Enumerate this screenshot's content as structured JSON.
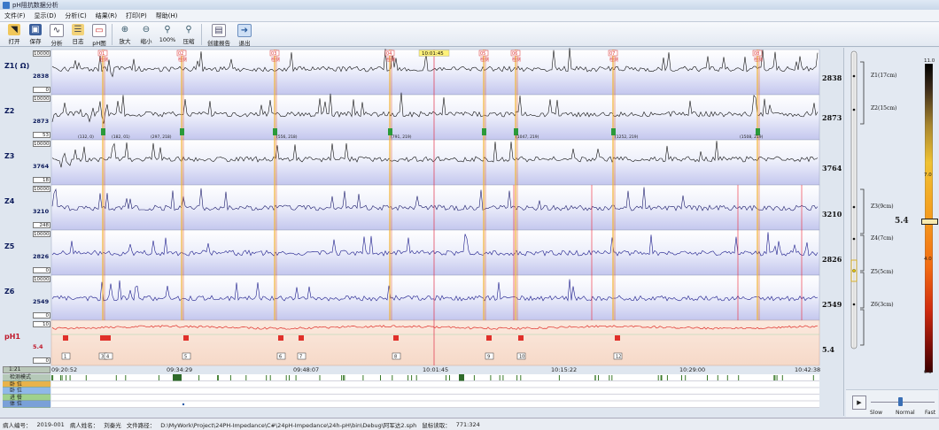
{
  "window": {
    "title": "pH阻抗数据分析"
  },
  "menu": [
    "文件(F)",
    "显示(D)",
    "分析(C)",
    "结果(R)",
    "打印(P)",
    "帮助(H)"
  ],
  "toolbar": [
    {
      "label": "打开",
      "icon": "folder-open-icon"
    },
    {
      "label": "保存",
      "icon": "save-icon"
    },
    {
      "label": "分析",
      "icon": "analysis-icon"
    },
    {
      "label": "日志",
      "icon": "log-icon"
    },
    {
      "label": "pH图",
      "icon": "ph-chart-icon"
    },
    {
      "label": "放大",
      "icon": "zoom-in-icon"
    },
    {
      "label": "缩小",
      "icon": "zoom-out-icon"
    },
    {
      "label": "100%",
      "icon": "zoom-100-icon"
    },
    {
      "label": "压缩",
      "icon": "compress-icon"
    },
    {
      "label": "创建报告",
      "icon": "report-icon"
    },
    {
      "label": "退出",
      "icon": "exit-icon"
    }
  ],
  "channels": [
    {
      "name": "Z1( Ω)",
      "current": "2838",
      "max": "10000",
      "min": "0",
      "value": "2838"
    },
    {
      "name": "Z2",
      "current": "2873",
      "max": "10000",
      "min": "53",
      "value": "2873"
    },
    {
      "name": "Z3",
      "current": "3764",
      "max": "10000",
      "min": "18",
      "value": "3764"
    },
    {
      "name": "Z4",
      "current": "3210",
      "max": "10000",
      "min": "248",
      "value": "3210"
    },
    {
      "name": "Z5",
      "current": "2826",
      "max": "10000",
      "min": "0",
      "value": "2826"
    },
    {
      "name": "Z6",
      "current": "2549",
      "max": "10000",
      "min": "0",
      "value": "2549"
    }
  ],
  "ph": {
    "name": "pH1",
    "current": "5.4",
    "max": "10",
    "min": "0",
    "value": "5.4"
  },
  "time_axis": [
    "09:20:52",
    "09:34:29",
    "09:48:07",
    "10:01:45",
    "10:15:22",
    "10:29:00",
    "10:42:38"
  ],
  "cursor_time": "10:01:45",
  "scale": "1:21",
  "event_markers": [
    "01",
    "02",
    "03",
    "04",
    "05",
    "06",
    "07",
    "08"
  ],
  "event_texts": [
    "检测",
    "检测",
    "检测",
    "检测",
    "检测",
    "检测",
    "检测",
    "检测"
  ],
  "ph_events": [
    "1",
    "3",
    "4",
    "5",
    "6",
    "7",
    "8",
    "9",
    "10",
    "12"
  ],
  "legend": [
    "检测模式",
    "卧  位",
    "卧  位",
    "进  餐",
    "体  位"
  ],
  "annotations_z2": [
    "(132, 0)",
    "(182, 01)",
    "(297, 218)",
    "(556, 218)",
    "(791, 219)",
    "(1047, 219)",
    "(1252, 219)",
    "(1508, 219)"
  ],
  "status": {
    "patient_no_label": "病人编号：",
    "patient_no": "2019-001",
    "patient_name_label": "病人姓名：",
    "patient_name": "刘秦光",
    "file_label": "文件路径：",
    "file": "D:\\MyWork\\Project\\24PH-Impedance\\C#\\24pH-Impedance\\24h-pH\\bin\\Debug\\阿军达2.sph",
    "coord_label": "鼠标读取：",
    "coord": "771:324"
  },
  "positions": [
    "Z1(17cm)",
    "Z2(15cm)",
    "Z3(9cm)",
    "Z4(7cm)",
    "Z5(5cm)",
    "Z6(3cm)"
  ],
  "colorbar": {
    "max": "11.0",
    "ticks": [
      "7.0",
      "4.0",
      "0.0"
    ],
    "current": "5.4"
  },
  "speed": {
    "slow": "Slow",
    "normal": "Normal",
    "fast": "Fast"
  }
}
